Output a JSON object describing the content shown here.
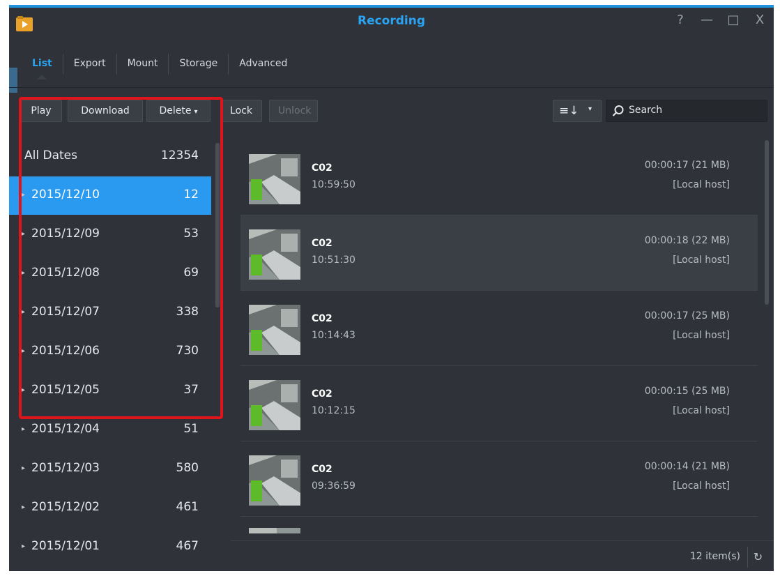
{
  "window": {
    "title": "Recording"
  },
  "window_controls": [
    "?",
    "—",
    "□",
    "X"
  ],
  "tabs": [
    {
      "label": "List",
      "active": true
    },
    {
      "label": "Export",
      "active": false
    },
    {
      "label": "Mount",
      "active": false
    },
    {
      "label": "Storage",
      "active": false
    },
    {
      "label": "Advanced",
      "active": false
    }
  ],
  "toolbar": {
    "play": "Play",
    "download": "Download",
    "delete": "Delete",
    "lock": "Lock",
    "unlock": "Unlock",
    "search_placeholder": "Search"
  },
  "dates": [
    {
      "label": "All Dates",
      "count": "12354",
      "selected": false
    },
    {
      "label": "2015/12/10",
      "count": "12",
      "selected": true
    },
    {
      "label": "2015/12/09",
      "count": "53",
      "selected": false
    },
    {
      "label": "2015/12/08",
      "count": "69",
      "selected": false
    },
    {
      "label": "2015/12/07",
      "count": "338",
      "selected": false
    },
    {
      "label": "2015/12/06",
      "count": "730",
      "selected": false
    },
    {
      "label": "2015/12/05",
      "count": "37",
      "selected": false
    },
    {
      "label": "2015/12/04",
      "count": "51",
      "selected": false
    },
    {
      "label": "2015/12/03",
      "count": "580",
      "selected": false
    },
    {
      "label": "2015/12/02",
      "count": "461",
      "selected": false
    },
    {
      "label": "2015/12/01",
      "count": "467",
      "selected": false
    }
  ],
  "recordings": [
    {
      "camera": "C02",
      "time": "10:59:50",
      "duration": "00:00:17 (21 MB)",
      "host": "[Local host]"
    },
    {
      "camera": "C02",
      "time": "10:51:30",
      "duration": "00:00:18 (22 MB)",
      "host": "[Local host]"
    },
    {
      "camera": "C02",
      "time": "10:14:43",
      "duration": "00:00:17 (25 MB)",
      "host": "[Local host]"
    },
    {
      "camera": "C02",
      "time": "10:12:15",
      "duration": "00:00:15 (25 MB)",
      "host": "[Local host]"
    },
    {
      "camera": "C02",
      "time": "09:36:59",
      "duration": "00:00:14 (21 MB)",
      "host": "[Local host]"
    }
  ],
  "footer": {
    "items": "12 item(s)"
  },
  "colors": {
    "accent": "#2a9af0",
    "highlight": "#e0141b",
    "background": "#2f3339"
  }
}
